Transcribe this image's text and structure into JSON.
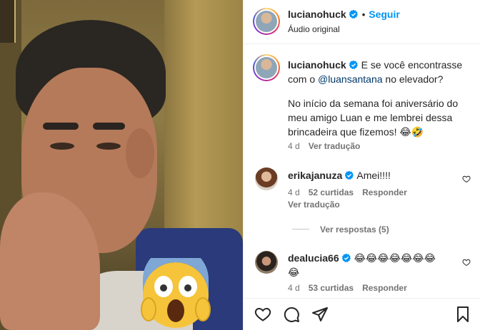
{
  "header": {
    "username": "lucianohuck",
    "follow_label": "Seguir",
    "audio_label": "Áudio original",
    "separator": "•"
  },
  "caption": {
    "username": "lucianohuck",
    "line1": "E se você encontrasse",
    "line2_prefix": "com o ",
    "mention": "@luansantana",
    "line2_suffix": " no elevador?",
    "paragraph2_line1": "No início da semana foi aniversário do",
    "paragraph2_line2": "meu amigo Luan e me lembrei dessa",
    "paragraph2_line3": "brincadeira que fizemos! 😂🤣",
    "time": "4 d",
    "translate": "Ver tradução"
  },
  "comments": [
    {
      "username": "erikajanuza",
      "text": "Amei!!!!",
      "time": "4 d",
      "likes": "52 curtidas",
      "reply": "Responder",
      "translate": "Ver tradução",
      "view_replies": "Ver respostas (5)"
    },
    {
      "username": "dealucia66",
      "text": "😂😂😂😂😂😂😂",
      "text_line2": "😂",
      "time": "4 d",
      "likes": "53 curtidas",
      "reply": "Responder"
    }
  ],
  "icons": {
    "like": "heart-icon",
    "comment": "comment-icon",
    "share": "share-icon",
    "save": "bookmark-icon",
    "verified": "verified-badge-icon",
    "comment_like": "heart-outline-icon"
  },
  "colors": {
    "accent": "#0095f6",
    "verified": "#0095f6",
    "mention": "#00376b",
    "muted": "#737373"
  }
}
